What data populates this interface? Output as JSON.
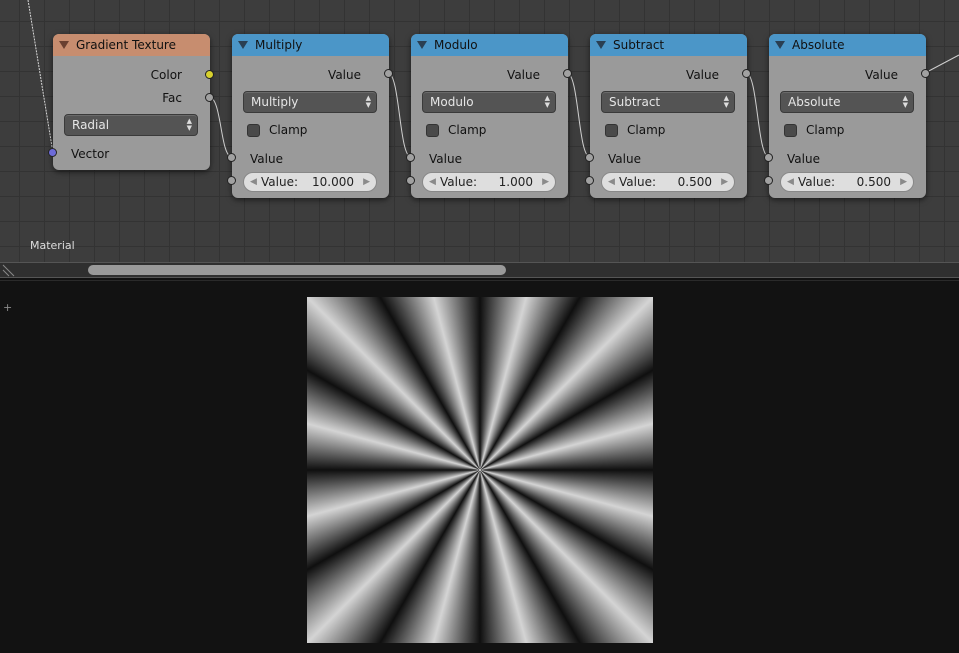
{
  "editor": {
    "label": "Material",
    "nodes": [
      {
        "title": "Gradient Texture",
        "outputs": [
          "Color",
          "Fac"
        ],
        "dropdown": "Radial",
        "input": "Vector"
      },
      {
        "title": "Multiply",
        "output": "Value",
        "operation": "Multiply",
        "clamp_label": "Clamp",
        "input_label": "Value",
        "value_label": "Value:",
        "value": "10.000"
      },
      {
        "title": "Modulo",
        "output": "Value",
        "operation": "Modulo",
        "clamp_label": "Clamp",
        "input_label": "Value",
        "value_label": "Value:",
        "value": "1.000"
      },
      {
        "title": "Subtract",
        "output": "Value",
        "operation": "Subtract",
        "clamp_label": "Clamp",
        "input_label": "Value",
        "value_label": "Value:",
        "value": "0.500"
      },
      {
        "title": "Absolute",
        "output": "Value",
        "operation": "Absolute",
        "clamp_label": "Clamp",
        "input_label": "Value",
        "value_label": "Value:",
        "value": "0.500"
      }
    ]
  },
  "preview": {
    "plus_icon": "+",
    "stripe_count": 12
  }
}
